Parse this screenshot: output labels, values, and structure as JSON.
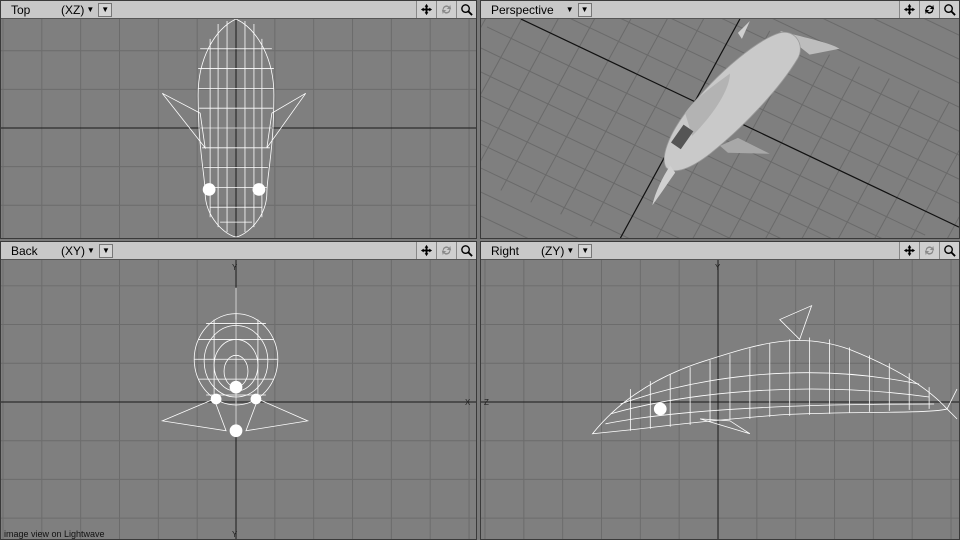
{
  "viewports": {
    "top": {
      "name": "Top",
      "axis": "(XZ)"
    },
    "persp": {
      "name": "Perspective"
    },
    "back": {
      "name": "Back",
      "axis": "(XY)"
    },
    "right": {
      "name": "Right",
      "axis": "(ZY)"
    }
  },
  "axis_labels": {
    "x": "X",
    "y": "Y",
    "z": "Z"
  },
  "caption": "image view on Lightwave",
  "icons": [
    "move-icon",
    "rotate-icon",
    "zoom-icon",
    "chevron-down-icon"
  ],
  "colors": {
    "viewport_bg": "#7f7f7f",
    "grid": "#6c6c6c",
    "axis": "#1a1a1a",
    "wire": "#ffffff",
    "header": "#c8c8c8"
  }
}
